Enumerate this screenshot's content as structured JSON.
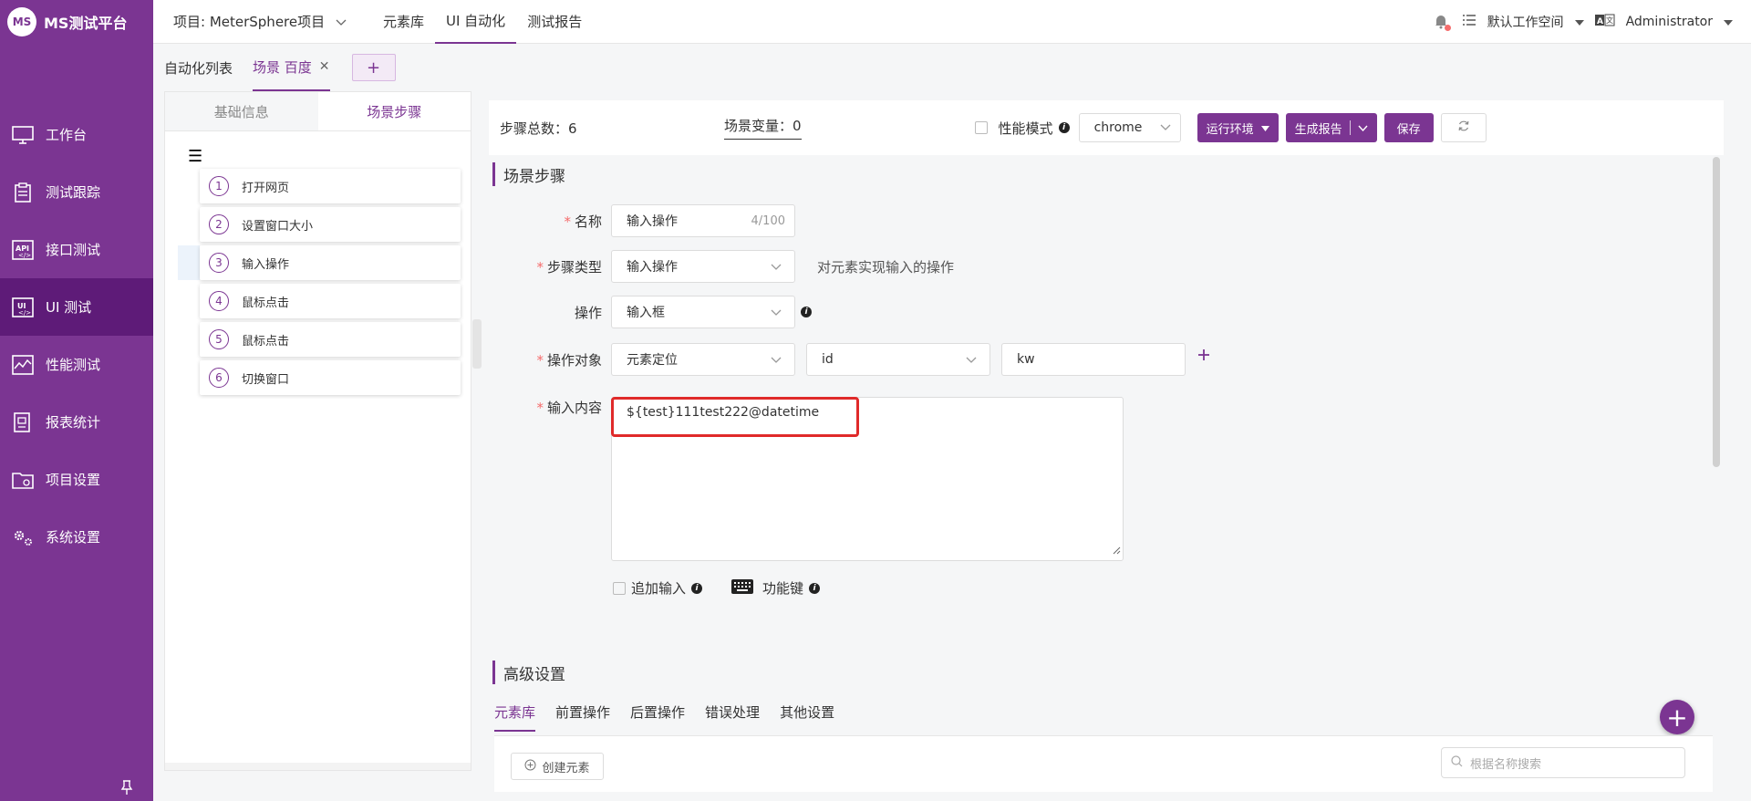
{
  "app": {
    "logo_text": "MS测试平台",
    "logo_mark": "MS"
  },
  "sidebar": {
    "items": [
      {
        "label": "工作台",
        "icon": "monitor-icon"
      },
      {
        "label": "测试跟踪",
        "icon": "clipboard-icon"
      },
      {
        "label": "接口测试",
        "icon": "api-icon"
      },
      {
        "label": "UI 测试",
        "icon": "ui-icon",
        "active": true
      },
      {
        "label": "性能测试",
        "icon": "chart-icon"
      },
      {
        "label": "报表统计",
        "icon": "report-icon"
      },
      {
        "label": "项目设置",
        "icon": "folder-icon"
      },
      {
        "label": "系统设置",
        "icon": "gears-icon"
      }
    ]
  },
  "topbar": {
    "project": "项目: MeterSphere项目",
    "menu": [
      "元素库",
      "UI 自动化",
      "测试报告"
    ],
    "active_menu": "UI 自动化",
    "workspace": "默认工作空间",
    "user": "Administrator"
  },
  "tabs": {
    "list_label": "自动化列表",
    "scene_label": "场景 百度",
    "add": "+"
  },
  "left_panel": {
    "tab_basic": "基础信息",
    "tab_steps": "场景步骤",
    "steps": [
      {
        "num": "1",
        "label": "打开网页"
      },
      {
        "num": "2",
        "label": "设置窗口大小"
      },
      {
        "num": "3",
        "label": "输入操作"
      },
      {
        "num": "4",
        "label": "鼠标点击"
      },
      {
        "num": "5",
        "label": "鼠标点击"
      },
      {
        "num": "6",
        "label": "切换窗口"
      }
    ]
  },
  "toolbar": {
    "step_total": "步骤总数：6",
    "scene_vars": "场景变量：0",
    "perf_mode": "性能模式",
    "browser": "chrome",
    "run_env": "运行环境",
    "gen_report": "生成报告",
    "save": "保存"
  },
  "form": {
    "section_title": "场景步骤",
    "name_label": "名称",
    "name_value": "输入操作",
    "name_count": "4/100",
    "type_label": "步骤类型",
    "type_value": "输入操作",
    "type_hint": "对元素实现输入的操作",
    "op_label": "操作",
    "op_value": "输入框",
    "target_label": "操作对象",
    "target_locator": "元素定位",
    "target_by": "id",
    "target_value": "kw",
    "content_label": "输入内容",
    "content_value": "${test}111test222@datetime",
    "append_input": "追加输入",
    "function_key": "功能键"
  },
  "advanced": {
    "title": "高级设置",
    "tabs": [
      "元素库",
      "前置操作",
      "后置操作",
      "错误处理",
      "其他设置"
    ],
    "create_element": "创建元素",
    "search_placeholder": "根据名称搜索"
  }
}
